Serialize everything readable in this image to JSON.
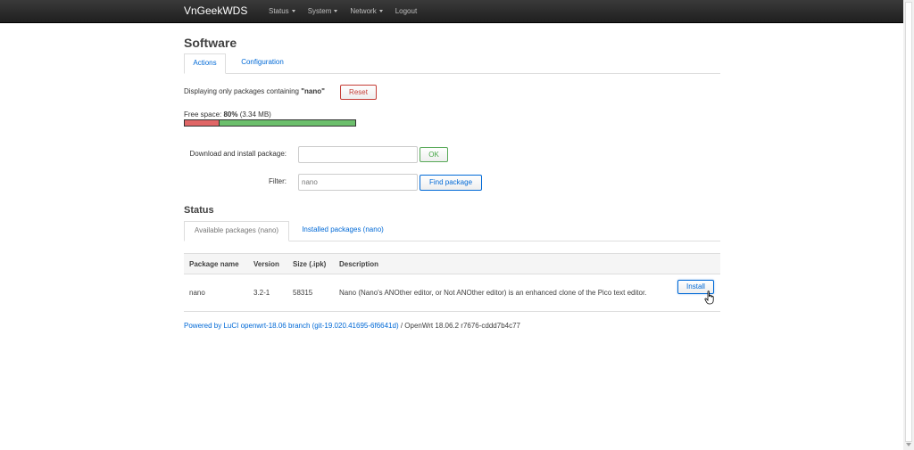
{
  "navbar": {
    "brand": "VnGeekWDS",
    "menu": [
      {
        "label": "Status",
        "has_dropdown": true
      },
      {
        "label": "System",
        "has_dropdown": true
      },
      {
        "label": "Network",
        "has_dropdown": true
      },
      {
        "label": "Logout",
        "has_dropdown": false
      }
    ]
  },
  "page": {
    "title": "Software",
    "tabs": [
      {
        "label": "Actions",
        "active": true
      },
      {
        "label": "Configuration",
        "active": false
      }
    ]
  },
  "filter_notice": {
    "prefix": "Displaying only packages containing ",
    "term": "\"nano\"",
    "reset_label": "Reset"
  },
  "free_space": {
    "label": "Free space: ",
    "percent_text": "80%",
    "size_text": " (3.34 MB)",
    "free_percent": 80
  },
  "download_form": {
    "label": "Download and install package:",
    "value": "",
    "placeholder": "",
    "ok_label": "OK"
  },
  "filter_form": {
    "label": "Filter:",
    "value": "nano",
    "find_label": "Find package"
  },
  "status": {
    "title": "Status",
    "tabs": [
      {
        "label": "Available packages (nano)",
        "active": true
      },
      {
        "label": "Installed packages (nano)",
        "active": false
      }
    ]
  },
  "table": {
    "headers": [
      "Package name",
      "Version",
      "Size (.ipk)",
      "Description"
    ],
    "rows": [
      {
        "name": "nano",
        "version": "3.2-1",
        "size": "58315",
        "description": "Nano (Nano's ANOther editor, or Not ANOther editor) is an enhanced clone of the Pico text editor.",
        "action_label": "Install"
      }
    ]
  },
  "footer": {
    "link_text": "Powered by LuCI openwrt-18.06 branch (git-19.020.41695-6f6641d)",
    "separator": " / ",
    "version_text": "OpenWrt 18.06.2 r7676-cddd7b4c77"
  },
  "colors": {
    "accent": "#0069d6",
    "danger": "#c43c35",
    "success": "#46a546",
    "navbar": "#222222"
  }
}
